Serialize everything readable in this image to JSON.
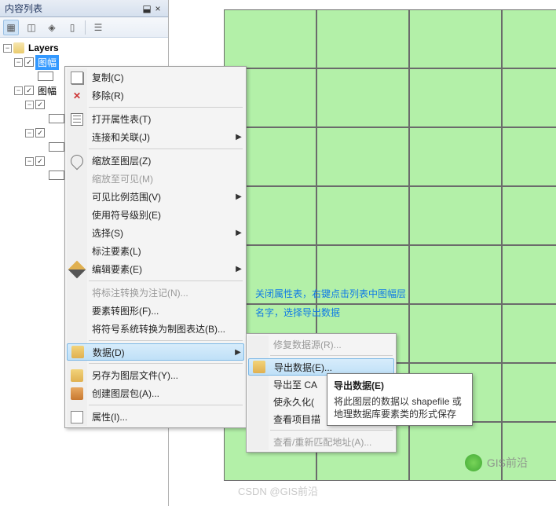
{
  "toc": {
    "title": "内容列表",
    "root": "Layers",
    "selected_layer": "图幅",
    "child_prefix": "图幅"
  },
  "annotation": {
    "line1": "关闭属性表，右键点击列表中图幅层",
    "line2": "名字，选择导出数据"
  },
  "menu": {
    "items": [
      {
        "label": "复制(C)",
        "icon": "copy"
      },
      {
        "label": "移除(R)",
        "icon": "remove"
      },
      {
        "sep": true
      },
      {
        "label": "打开属性表(T)",
        "icon": "table"
      },
      {
        "label": "连接和关联(J)",
        "arrow": true
      },
      {
        "sep": true
      },
      {
        "label": "缩放至图层(Z)",
        "icon": "zoom"
      },
      {
        "label": "缩放至可见(M)",
        "disabled": true
      },
      {
        "label": "可见比例范围(V)",
        "arrow": true
      },
      {
        "label": "使用符号级别(E)"
      },
      {
        "label": "选择(S)",
        "arrow": true
      },
      {
        "label": "标注要素(L)"
      },
      {
        "label": "编辑要素(E)",
        "icon": "edit",
        "arrow": true
      },
      {
        "sep": true
      },
      {
        "label": "将标注转换为注记(N)...",
        "disabled": true
      },
      {
        "label": "要素转图形(F)..."
      },
      {
        "label": "将符号系统转换为制图表达(B)..."
      },
      {
        "sep": true
      },
      {
        "label": "数据(D)",
        "icon": "data",
        "arrow": true,
        "highlight": true
      },
      {
        "sep": true
      },
      {
        "label": "另存为图层文件(Y)...",
        "icon": "save"
      },
      {
        "label": "创建图层包(A)...",
        "icon": "pkg"
      },
      {
        "sep": true
      },
      {
        "label": "属性(I)...",
        "icon": "prop"
      }
    ]
  },
  "submenu": {
    "items": [
      {
        "label": "修复数据源(R)...",
        "disabled": true
      },
      {
        "sep": true
      },
      {
        "label": "导出数据(E)...",
        "highlight": true,
        "icon": "save"
      },
      {
        "label": "导出至 CA"
      },
      {
        "label": "使永久化("
      },
      {
        "label": "查看项目描"
      },
      {
        "sep": true
      },
      {
        "label": "查看/重新匹配地址(A)...",
        "disabled": true
      }
    ]
  },
  "tooltip": {
    "title": "导出数据(E)",
    "body": "将此图层的数据以 shapefile 或地理数据库要素类的形式保存"
  },
  "watermark": {
    "text": "GIS前沿"
  },
  "csdn": "CSDN @GIS前沿"
}
